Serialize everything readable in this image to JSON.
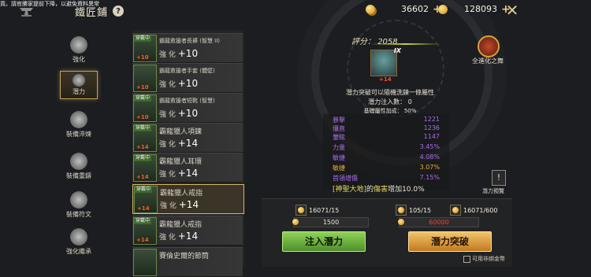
{
  "notice": "貨。請官勝家提前下降，以避免資料異常",
  "header": {
    "title": "鐵匠鋪",
    "help_icon": "?",
    "currency1": "36602",
    "currency2": "128093",
    "close": "✕"
  },
  "nav": [
    {
      "label": "強化"
    },
    {
      "label": "潛力"
    },
    {
      "label": "裝備淬煉"
    },
    {
      "label": "裝備重鑄"
    },
    {
      "label": "裝備符文"
    },
    {
      "label": "強化繼承"
    }
  ],
  "items": [
    {
      "tag": "穿戴中",
      "name": "霸龍救援者長褲 (智慧 II)",
      "enh": "強 化",
      "plus": "+10",
      "lv": "+10"
    },
    {
      "tag": "",
      "name": "霸龍救援者手套 (體壁)",
      "enh": "強 化",
      "plus": "+10",
      "lv": "+10"
    },
    {
      "tag": "穿戴中",
      "name": "霸龍救援者短靴 (智慧)",
      "enh": "強 化",
      "plus": "+10",
      "lv": "+10"
    },
    {
      "tag": "穿戴中",
      "name": "霸龍獵人項鍊",
      "enh": "強 化",
      "plus": "+14",
      "lv": "+14"
    },
    {
      "tag": "穿戴中",
      "name": "霸龍獵人耳環",
      "enh": "強 化",
      "plus": "+14",
      "lv": "+14"
    },
    {
      "tag": "穿戴中",
      "name": "霸龍獵人戒指",
      "enh": "強 化",
      "plus": "+14",
      "lv": "+14"
    },
    {
      "tag": "穿戴中",
      "name": "霸龍獵人戒指",
      "enh": "強 化",
      "plus": "+14",
      "lv": "+14"
    },
    {
      "tag": "",
      "name": "賽倫史爾的節筒",
      "enh": "",
      "plus": "",
      "lv": ""
    }
  ],
  "center": {
    "score_label": "評分：",
    "score": "2058",
    "item_badge": "IX",
    "item_level": "+14",
    "desc": "潛力突破可以隨機洗鍊一條屬性",
    "inject_count": "潛力注入數： 0",
    "base_bonus": "基礎屬性加成： 50%"
  },
  "stats": [
    {
      "k": "暴擊",
      "v": "1221",
      "color": "#a86cf0"
    },
    {
      "k": "僵直",
      "v": "1236",
      "color": "#a86cf0"
    },
    {
      "k": "暈眩",
      "v": "1147",
      "color": "#a86cf0"
    },
    {
      "k": "力量",
      "v": "3.45%",
      "color": "#a86cf0"
    },
    {
      "k": "敏捷",
      "v": "4.08%",
      "color": "#a86cf0"
    },
    {
      "k": "敏捷",
      "v": "3.07%",
      "color": "#e8a93a"
    },
    {
      "k": "首領增傷",
      "v": "7.15%",
      "color": "#a86cf0"
    }
  ],
  "bonus": {
    "prefix": "[神聖大地]",
    "middle": "的",
    "hl": "傷害",
    "suffix": "增加10.0%"
  },
  "right": {
    "label": "全進化之舞",
    "preview_icon": "!",
    "preview_label": "潛力預覽"
  },
  "bottom": {
    "left_res": "16071/15",
    "left_cost": "1500",
    "inject_button": "注入潛力",
    "right_res1": "105/15",
    "right_res2": "16071/600",
    "right_cost": "60000",
    "break_button": "潛力突破",
    "checkbox_label": "可用非綁金幣"
  }
}
